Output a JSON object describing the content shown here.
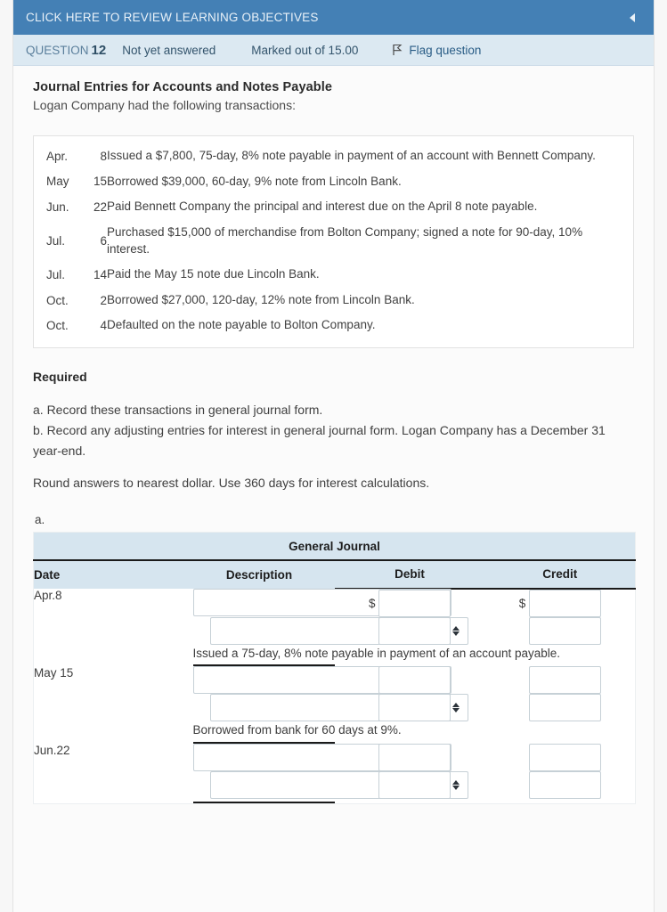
{
  "objectives_bar": {
    "label": "CLICK HERE TO REVIEW LEARNING OBJECTIVES",
    "collapse_icon": "triangle-left-icon",
    "bg_color": "#4480b5"
  },
  "question_info": {
    "question_word": "QUESTION",
    "question_number": "12",
    "state": "Not yet answered",
    "marks": "Marked out of 15.00",
    "flag_label": "Flag question",
    "flag_icon": "flag-icon",
    "bg_color": "#dce9f2"
  },
  "question": {
    "title": "Journal Entries for Accounts and Notes Payable",
    "intro": "Logan Company had the following transactions:"
  },
  "transactions": [
    {
      "month": "Apr.",
      "day": "8",
      "description": "Issued a $7,800, 75-day, 8% note payable in payment of an account with Bennett Company."
    },
    {
      "month": "May",
      "day": "15",
      "description": "Borrowed $39,000, 60-day, 9% note from Lincoln Bank."
    },
    {
      "month": "Jun.",
      "day": "22",
      "description": "Paid Bennett Company the principal and interest due on the April 8 note payable."
    },
    {
      "month": "Jul.",
      "day": "6",
      "description": "Purchased $15,000 of merchandise from Bolton Company; signed a note for 90-day, 10% interest."
    },
    {
      "month": "Jul.",
      "day": "14",
      "description": "Paid the May 15 note due Lincoln Bank."
    },
    {
      "month": "Oct.",
      "day": "2",
      "description": "Borrowed $27,000, 120-day, 12% note from Lincoln Bank."
    },
    {
      "month": "Oct.",
      "day": "4",
      "description": "Defaulted on the note payable to Bolton Company."
    }
  ],
  "required": {
    "heading": "Required",
    "item_a": "a. Record these transactions in general journal form.",
    "item_b": "b. Record any adjusting entries for interest in general journal form. Logan Company has a December 31 year-end.",
    "note": "Round answers to nearest dollar. Use 360 days for interest calculations.",
    "part_label": "a."
  },
  "journal": {
    "title": "General Journal",
    "columns": {
      "date": "Date",
      "description": "Description",
      "debit": "Debit",
      "credit": "Credit"
    },
    "select_placeholder": "",
    "debit_placeholder": "",
    "credit_placeholder": "",
    "dollar_sign": "$",
    "select_icon": "updown-arrows-icon",
    "entries": [
      {
        "date": "Apr.8",
        "line1_value": "",
        "line2_value": "",
        "line1_debit": "",
        "line1_credit": "",
        "line2_debit": "",
        "line2_credit": "",
        "show_dollar": true,
        "explanation": "Issued a 75-day, 8% note payable in payment of an account payable."
      },
      {
        "date": "May 15",
        "line1_value": "",
        "line2_value": "",
        "line1_debit": "",
        "line1_credit": "",
        "line2_debit": "",
        "line2_credit": "",
        "show_dollar": false,
        "explanation": "Borrowed from bank for 60 days at 9%."
      },
      {
        "date": "Jun.22",
        "line1_value": "",
        "line2_value": "",
        "line1_debit": "",
        "line1_credit": "",
        "line2_debit": "",
        "line2_credit": "",
        "show_dollar": false,
        "explanation": ""
      }
    ]
  }
}
